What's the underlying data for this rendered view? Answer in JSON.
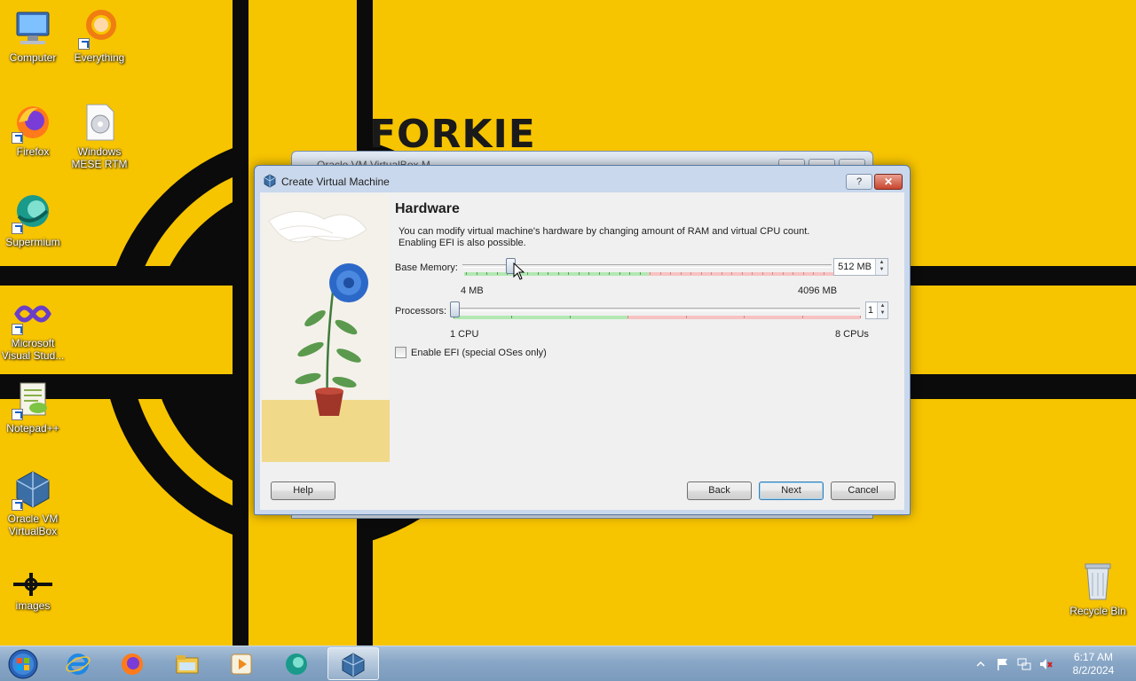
{
  "wallpaper": {
    "text": "FORKIE"
  },
  "desktop_icons": [
    {
      "label": "Computer"
    },
    {
      "label": "Everything"
    },
    {
      "label": "Firefox"
    },
    {
      "label": "Windows MESE RTM"
    },
    {
      "label": "Supermium"
    },
    {
      "label": "Microsoft Visual Stud..."
    },
    {
      "label": "Notepad++"
    },
    {
      "label": "Oracle VM VirtualBox"
    },
    {
      "label": "images"
    },
    {
      "label": "Recycle Bin"
    }
  ],
  "background_window": {
    "title": "Oracle VM VirtualBox M..."
  },
  "dialog": {
    "title": "Create Virtual Machine",
    "help_ctrl": "?",
    "close_ctrl": "✕",
    "heading": "Hardware",
    "description": "You can modify virtual machine's hardware by changing amount of RAM and virtual CPU count. Enabling EFI is also possible.",
    "base_memory": {
      "label": "Base Memory:",
      "value": 512,
      "value_text": "512 MB",
      "min": 4,
      "max": 4096,
      "min_label": "4 MB",
      "max_label": "4096 MB"
    },
    "processors": {
      "label": "Processors:",
      "value": 1,
      "value_text": "1",
      "min_label": "1 CPU",
      "max_label": "8 CPUs"
    },
    "efi": {
      "label": "Enable EFI (special OSes only)",
      "checked": false
    },
    "buttons": {
      "help": "Help",
      "back": "Back",
      "next": "Next",
      "cancel": "Cancel"
    }
  },
  "taskbar": {
    "apps": [
      "start-orb",
      "internet-explorer-icon",
      "firefox-icon",
      "file-explorer-icon",
      "media-player-icon",
      "supermium-icon",
      "virtualbox-icon"
    ],
    "clock_time": "6:17 AM",
    "clock_date": "8/2/2024"
  },
  "colors": {
    "slider_green": "#9be39b",
    "slider_red": "#f5b3b3",
    "taskbar": "#88a6c6",
    "wallpaper_yellow": "#f7c400"
  }
}
